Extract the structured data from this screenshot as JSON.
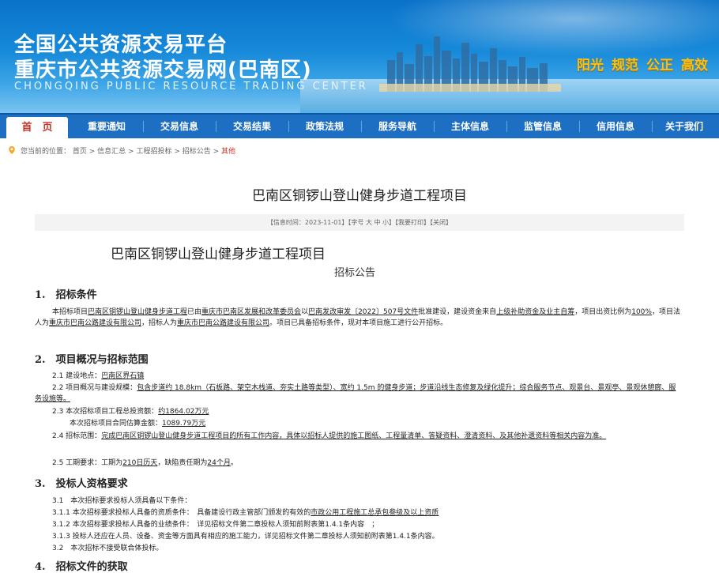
{
  "header": {
    "title_line1": "全国公共资源交易平台",
    "title_line2": "重庆市公共资源交易网(巴南区)",
    "title_en": "CHONGQING PUBLIC RESOURCE TRADING CENTER",
    "slogan": [
      "阳光",
      "规范",
      "公正",
      "高效"
    ]
  },
  "nav": {
    "items": [
      "首　页",
      "重要通知",
      "交易信息",
      "交易结果",
      "政策法规",
      "服务导航",
      "主体信息",
      "监管信息",
      "信用信息",
      "关于我们"
    ]
  },
  "breadcrumb": {
    "prefix": "您当前的位置：",
    "items": [
      "首页",
      "信息汇总",
      "工程招投标",
      "招标公告"
    ],
    "current": "其他",
    "sep": " > "
  },
  "article": {
    "title": "巴南区铜锣山登山健身步道工程项目",
    "info": "【信息时间：2023-11-01】【字号 大 中 小】【我要打印】【关闭】",
    "doc_title": "巴南区铜锣山登山健身步道工程项目",
    "doc_subtitle": "招标公告",
    "s1_heading": "1.　招标条件",
    "s1_p": {
      "a": "本招标项目",
      "b": "巴南区铜锣山登山健身步道工程",
      "c": "已由",
      "d": "重庆市巴南区发展和改革委员会",
      "e": "以",
      "f": "巴南发改审发〔2022〕507号文件",
      "g": "批准建设，建设资金来自",
      "h": "上级补助资金及业主自筹",
      "i": "，项目出资比例为",
      "j": "100%",
      "k": "，项目法人为",
      "l": "重庆市巴南公路建设有限公司",
      "m": "，招标人为",
      "n": "重庆市巴南公路建设有限公司",
      "o": "。项目已具备招标条件，现对本项目施工进行公开招标。"
    },
    "s2_heading": "2.　项目概况与招标范围",
    "s2_1_label": "2.1 建设地点：",
    "s2_1_val": "巴南区界石镇",
    "s2_2_label": "2.2 项目概况与建设规模：",
    "s2_2_val": "包含步道约 18.8km（石板路、架空木栈道、夯实土路等类型）、宽约 1.5m 的健身步道；步道沿线生态修复及绿化提升；综合服务节点、观景台、景观亭、景观休憩廊、服务设施等。",
    "s2_3_label": "2.3 本次招标项目工程总投资额：",
    "s2_3_val": "约1864.02万元",
    "s2_3b_label": "本次招标项目合同估算金额：",
    "s2_3b_val": "1089.79万元",
    "s2_4_label": "2.4 招标范围：",
    "s2_4_val": "完成巴南区铜锣山登山健身步道工程项目的所有工作内容，具体以招标人提供的施工图纸、工程量清单、答疑资料、澄清资料、及其他补遗资料等相关内容为准。",
    "s2_5_a": "2.5 工期要求：工期为",
    "s2_5_b": "210日历天",
    "s2_5_c": "，缺陷责任期为",
    "s2_5_d": "24个月",
    "s2_5_e": "。",
    "s3_heading": "3.　投标人资格要求",
    "s3_1": "3.1　本次招标要求投标人须具备以下条件：",
    "s3_1_1_a": "3.1.1 本次招标要求投标人具备的资质条件：　具备建设行政主管部门颁发的有效的",
    "s3_1_1_b": "市政公用工程施工总承包叁级及以上资质",
    "s3_1_2": "3.1.2 本次招标要求投标人具备的业绩条件：　详见招标文件第二章投标人须知前附表第1.4.1条内容　；",
    "s3_1_3": "3.1.3 投标人还应在人员、设备、资金等方面具有相应的施工能力，详见招标文件第二章投标人须知前附表第1.4.1条内容。",
    "s3_2": "3.2　本次招标不接受联合体投标。",
    "s4_heading": "4.　招标文件的获取"
  },
  "colors": {
    "banner": "#1689d9",
    "nav": "#1c6fc2",
    "slogan": "#f6c315",
    "accent_red": "#c5362a"
  }
}
